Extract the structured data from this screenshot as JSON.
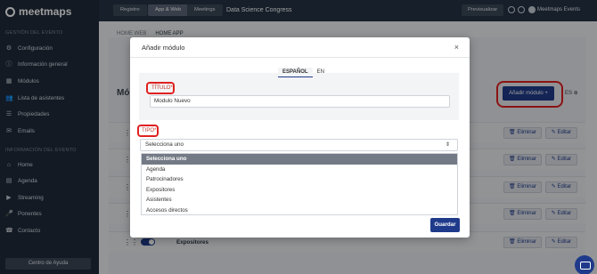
{
  "brand": {
    "logo_text": "meetmaps"
  },
  "topbar": {
    "buttons": [
      "Registro",
      "App & Web",
      "Meetings"
    ],
    "event_title": "Data Science Congress",
    "preview_label": "Previsualizar",
    "user_name": "Meetmaps Events"
  },
  "sidebar": {
    "section_event_mgmt": "GESTIÓN DEL EVENTO",
    "items_mgmt": [
      "Configuración",
      "Información general",
      "Módulos",
      "Lista de asistentes",
      "Propiedades",
      "Emails"
    ],
    "section_event_info": "INFORMACIÓN DEL EVENTO",
    "items_info": [
      "Home",
      "Agenda",
      "Streaming",
      "Ponentes",
      "Contacto"
    ],
    "help_label": "Centro de Ayuda"
  },
  "breadcrumb": {
    "items": [
      "HOME WEB",
      "HOME APP"
    ]
  },
  "page": {
    "heading_partial": "Mó",
    "add_module_label": "Añadir módulo",
    "lang_code": "ES",
    "delete_label": "Eliminar",
    "edit_label": "Editar",
    "last_row_label": "Expositores"
  },
  "modal": {
    "title": "Añadir módulo",
    "close_glyph": "×",
    "tabs": [
      "ESPAÑOL",
      "EN"
    ],
    "title_label": "TÍTULO*",
    "title_value": "Modulo Nuevo",
    "type_label": "TIPO*",
    "type_selected": "Selecciona uno",
    "type_options": [
      "Selecciona uno",
      "Agenda",
      "Patrocinadores",
      "Expositores",
      "Asistentes",
      "Accesos directos"
    ],
    "save_label": "Guardar"
  },
  "colors": {
    "primary": "#1f3a8a",
    "sidebar": "#1f2b3a",
    "highlight": "#e02020"
  }
}
